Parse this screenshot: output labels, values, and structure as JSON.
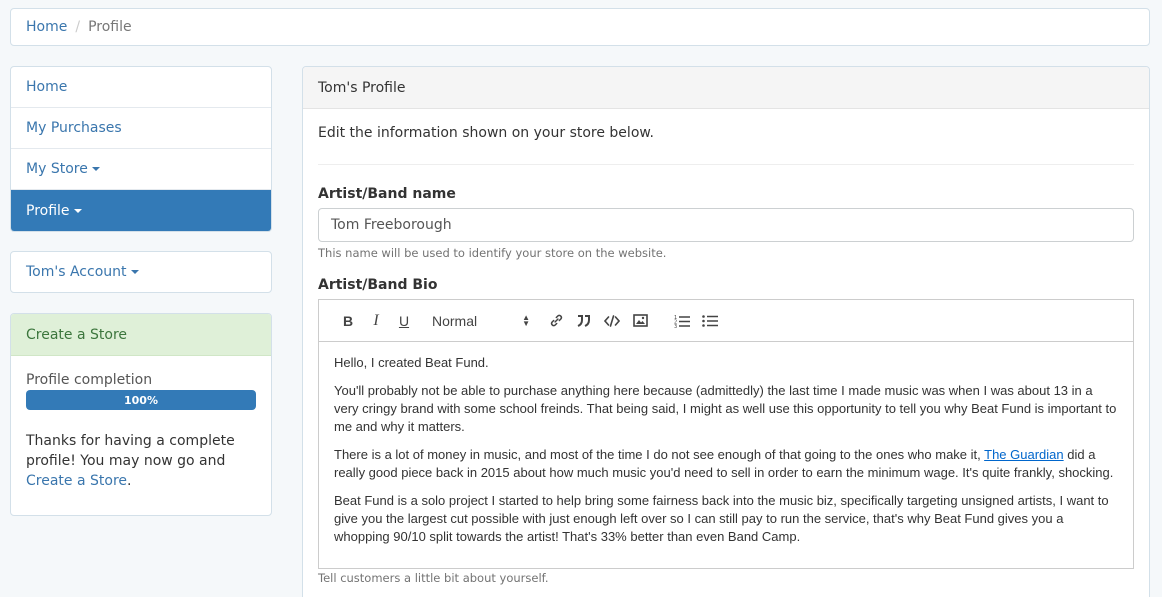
{
  "breadcrumb": {
    "home": "Home",
    "current": "Profile"
  },
  "sidebar": {
    "items": [
      {
        "label": "Home"
      },
      {
        "label": "My Purchases"
      },
      {
        "label": "My Store"
      },
      {
        "label": "Profile"
      }
    ],
    "account": "Tom's Account"
  },
  "store_card": {
    "title": "Create a Store",
    "completion_label": "Profile completion",
    "completion_text": "100%",
    "completion_value": 100,
    "message_prefix": "Thanks for having a complete profile! You may now go and ",
    "message_link": "Create a Store",
    "message_suffix": "."
  },
  "panel": {
    "title": "Tom's Profile",
    "intro": "Edit the information shown on your store below.",
    "name_label": "Artist/Band name",
    "name_value": "Tom Freeborough",
    "name_help": "This name will be used to identify your store on the website.",
    "bio_label": "Artist/Band Bio",
    "bio_help": "Tell customers a little bit about yourself.",
    "toolbar": {
      "bold": "B",
      "italic": "I",
      "underline": "U",
      "style_select": "Normal"
    },
    "bio": {
      "p1": "Hello, I created Beat Fund.",
      "p2": "You'll probably not be able to purchase anything here because (admittedly) the last time I made music was when I was about 13 in a very cringy brand with some school freinds. That being said, I might as well use this opportunity to tell you why Beat Fund is important to me and why it matters.",
      "p3_before": "There is a lot of money in music, and most of the time I do not see enough of that going to the ones who make it, ",
      "p3_link": "The Guardian",
      "p3_after": " did a really good piece back in 2015 about how much music you'd need to sell in order to earn the minimum wage. It's quite frankly, shocking.",
      "p4": "Beat Fund is a solo project I started to help bring some fairness back into the music biz, specifically targeting unsigned artists, I want to give you the largest cut possible with just enough left over so I can still pay to run the service, that's why Beat Fund gives you a whopping 90/10 split towards the artist! That's 33% better than even Band Camp."
    }
  }
}
